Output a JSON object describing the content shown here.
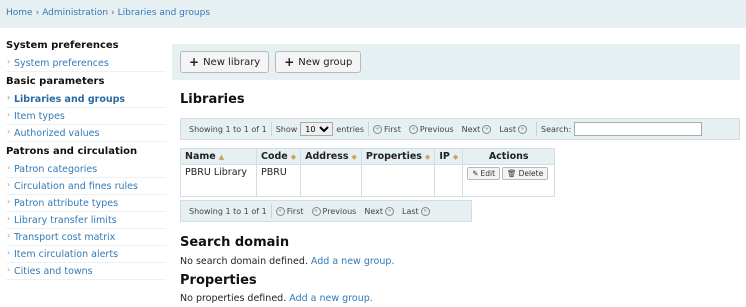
{
  "breadcrumb": {
    "items": [
      "Home",
      "Administration",
      "Libraries and groups"
    ]
  },
  "sidebar": {
    "groups": [
      {
        "heading": "System preferences",
        "items": [
          "System preferences"
        ]
      },
      {
        "heading": "Basic parameters",
        "items": [
          "Libraries and groups",
          "Item types",
          "Authorized values"
        ]
      },
      {
        "heading": "Patrons and circulation",
        "items": [
          "Patron categories",
          "Circulation and fines rules",
          "Patron attribute types",
          "Library transfer limits",
          "Transport cost matrix",
          "Item circulation alerts",
          "Cities and towns"
        ]
      }
    ],
    "active": "Libraries and groups"
  },
  "toolbar": {
    "new_library": "New library",
    "new_group": "New group"
  },
  "libraries": {
    "title": "Libraries",
    "info": "Showing 1 to 1 of 1",
    "show_label": "Show",
    "entries_value": "10",
    "entries_label": "entries",
    "first": "First",
    "previous": "Previous",
    "next": "Next",
    "last": "Last",
    "search_label": "Search:",
    "columns": [
      "Name",
      "Code",
      "Address",
      "Properties",
      "IP",
      "Actions"
    ],
    "rows": [
      {
        "name": "PBRU Library",
        "code": "PBRU",
        "address": "",
        "properties": "",
        "ip": ""
      }
    ],
    "edit_label": "Edit",
    "delete_label": "Delete"
  },
  "search_domain": {
    "title": "Search domain",
    "text": "No search domain defined.",
    "link": "Add a new group."
  },
  "properties": {
    "title": "Properties",
    "text": "No properties defined.",
    "link": "Add a new group."
  }
}
